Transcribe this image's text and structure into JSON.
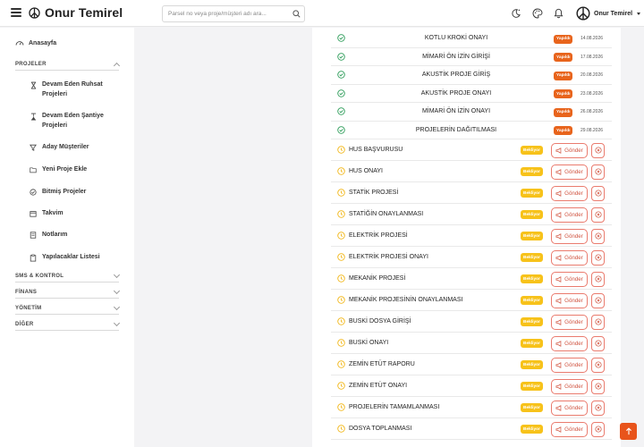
{
  "header": {
    "brand": "Onur Temirel",
    "search_placeholder": "Parsel no veya proje/müşteri adı ara...",
    "user_name": "Onur Temirel"
  },
  "sidebar": {
    "home_label": "Anasayfa",
    "projects_section": "PROJELER",
    "items": [
      {
        "label": "Devam Eden Ruhsat Projeleri",
        "icon": "hourglass-icon"
      },
      {
        "label": "Devam Eden Şantiye Projeleri",
        "icon": "hourglass-bottom-icon"
      },
      {
        "label": "Aday Müşteriler",
        "icon": "filter-icon"
      },
      {
        "label": "Yeni Proje Ekle",
        "icon": "folder-plus-icon"
      },
      {
        "label": "Bitmiş Projeler",
        "icon": "check-circle-icon"
      },
      {
        "label": "Takvim",
        "icon": "calendar-icon"
      },
      {
        "label": "Notlarım",
        "icon": "notes-icon"
      },
      {
        "label": "Yapılacaklar Listesi",
        "icon": "clipboard-icon"
      }
    ],
    "sections": [
      {
        "label": "SMS & KONTROL"
      },
      {
        "label": "FİNANS"
      },
      {
        "label": "YÖNETİM"
      },
      {
        "label": "DİĞER"
      }
    ]
  },
  "tasks_done": [
    {
      "title": "KOTLU KROKİ ONAYI",
      "status": "Yapıldı",
      "date": "14.08.2026"
    },
    {
      "title": "MİMARİ ÖN İZİN GİRİŞİ",
      "status": "Yapıldı",
      "date": "17.08.2026"
    },
    {
      "title": "AKUSTİK PROJE GİRİŞ",
      "status": "Yapıldı",
      "date": "20.08.2026"
    },
    {
      "title": "AKUSTİK PROJE ONAYI",
      "status": "Yapıldı",
      "date": "23.08.2026"
    },
    {
      "title": "MİMARİ ÖN İZİN ONAYI",
      "status": "Yapıldı",
      "date": "26.08.2026"
    },
    {
      "title": "PROJELERİN DAĞITILMASI",
      "status": "Yapıldı",
      "date": "29.08.2026"
    }
  ],
  "tasks_waiting": [
    {
      "title": "HUS BAŞVURUSU",
      "status": "Bekliyor"
    },
    {
      "title": "HUS ONAYI",
      "status": "Bekliyor"
    },
    {
      "title": "STATİK PROJESİ",
      "status": "Bekliyor"
    },
    {
      "title": "STATİĞİN ONAYLANMASI",
      "status": "Bekliyor"
    },
    {
      "title": "ELEKTRİK PROJESİ",
      "status": "Bekliyor"
    },
    {
      "title": "ELEKTRİK PROJESİ ONAYI",
      "status": "Bekliyor"
    },
    {
      "title": "MEKANİK PROJESİ",
      "status": "Bekliyor"
    },
    {
      "title": "MEKANİK PROJESİNİN ONAYLANMASI",
      "status": "Bekliyor"
    },
    {
      "title": "BUSKİ DOSYA GİRİŞİ",
      "status": "Bekliyor"
    },
    {
      "title": "BUSKİ ONAYI",
      "status": "Bekliyor"
    },
    {
      "title": "ZEMİN ETÜT RAPORU",
      "status": "Bekliyor"
    },
    {
      "title": "ZEMİN ETÜT ONAYI",
      "status": "Bekliyor"
    },
    {
      "title": "PROJELERİN TAMAMLANMASI",
      "status": "Bekliyor"
    },
    {
      "title": "DOSYA TOPLANMASI",
      "status": "Bekliyor"
    }
  ],
  "send_label": "Gönder",
  "colors": {
    "done_badge": "#e8641c",
    "wait_badge": "#f7c21a",
    "send_border": "#ea7b6e",
    "check_green": "#2e9d5a",
    "clock_yellow": "#f2b718",
    "scroll_top_bg": "#e8541c"
  }
}
